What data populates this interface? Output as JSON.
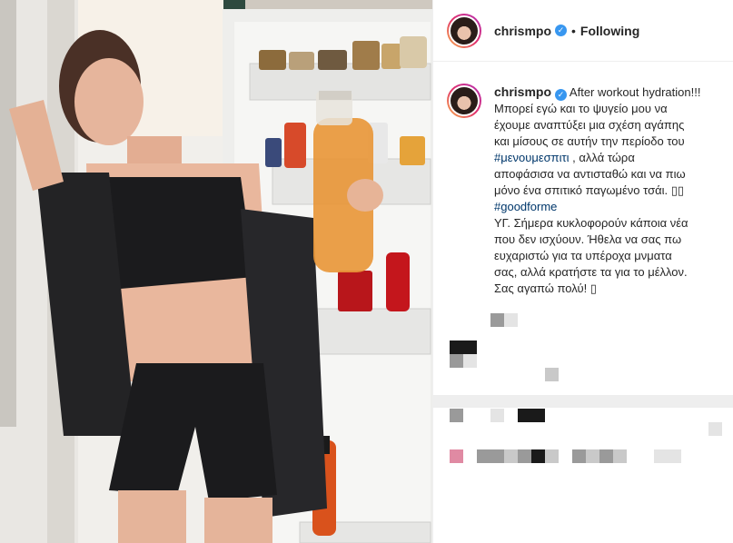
{
  "post": {
    "username": "chrismpo",
    "verified_mark": "✓",
    "separator": "•",
    "follow_state": "Following"
  },
  "caption": {
    "username": "chrismpo",
    "verified_mark": "✓",
    "line1": "After workout hydration!!!",
    "line2": "Μπορεί εγώ και το ψυγείο μου να",
    "line3": "έχουμε αναπτύξει μια σχέση αγάπης",
    "line4": "και μίσους σε αυτήν την περίοδο του",
    "hashtag1": "#μενουμεσπιτι",
    "line5_after": " , αλλά τώρα",
    "line6": "αποφάσισα να αντισταθώ και να πιω",
    "line7": "μόνο ένα σπιτικό παγωμένο τσάι. ▯▯",
    "hashtag2": "#goodforme",
    "line8": "ΥΓ. Σήμερα κυκλοφορούν κάποια νέα",
    "line9": "που δεν ισχύουν. Ήθελα να σας πω",
    "line10": "ευχαριστώ για τα υπέροχα μνματα",
    "line11": "σας, αλλά κρατήστε τα για το μέλλον.",
    "line12": "Σας αγαπώ πολύ! ▯"
  },
  "icons": {
    "verified": "verified-badge-icon"
  },
  "colors": {
    "hashtag": "#00376b",
    "verified": "#3897f0",
    "text": "#262626"
  }
}
